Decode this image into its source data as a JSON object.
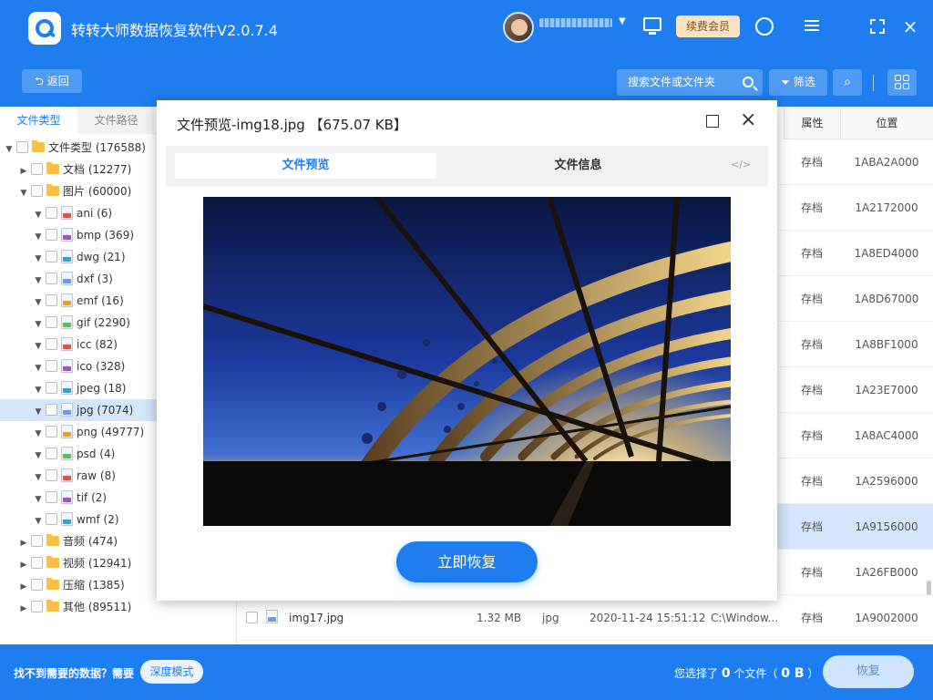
{
  "app": {
    "title": "转转大师数据恢复软件V2.0.7.4",
    "vip_label": "续费会员"
  },
  "toolbar": {
    "back_label": "返回",
    "search_placeholder": "搜索文件或文件夹",
    "filter_label": "筛选"
  },
  "sidebar": {
    "tabs": [
      "文件类型",
      "文件路径"
    ],
    "tree": [
      {
        "label": "文件类型 (176588)",
        "level": 0,
        "kind": "folder",
        "expanded": true
      },
      {
        "label": "文档 (12277)",
        "level": 1,
        "kind": "folder",
        "expanded": false
      },
      {
        "label": "图片 (60000)",
        "level": 1,
        "kind": "folder",
        "expanded": true
      },
      {
        "label": "ani (6)",
        "level": 2,
        "kind": "file"
      },
      {
        "label": "bmp (369)",
        "level": 2,
        "kind": "file"
      },
      {
        "label": "dwg (21)",
        "level": 2,
        "kind": "file"
      },
      {
        "label": "dxf (3)",
        "level": 2,
        "kind": "file"
      },
      {
        "label": "emf (16)",
        "level": 2,
        "kind": "file"
      },
      {
        "label": "gif (2290)",
        "level": 2,
        "kind": "file"
      },
      {
        "label": "icc (82)",
        "level": 2,
        "kind": "file"
      },
      {
        "label": "ico (328)",
        "level": 2,
        "kind": "file"
      },
      {
        "label": "jpeg (18)",
        "level": 2,
        "kind": "file"
      },
      {
        "label": "jpg (7074)",
        "level": 2,
        "kind": "file",
        "selected": true
      },
      {
        "label": "png (49777)",
        "level": 2,
        "kind": "file"
      },
      {
        "label": "psd (4)",
        "level": 2,
        "kind": "file"
      },
      {
        "label": "raw (8)",
        "level": 2,
        "kind": "file"
      },
      {
        "label": "tif (2)",
        "level": 2,
        "kind": "file"
      },
      {
        "label": "wmf (2)",
        "level": 2,
        "kind": "file"
      },
      {
        "label": "音频 (474)",
        "level": 1,
        "kind": "folder",
        "expanded": false
      },
      {
        "label": "视频 (12941)",
        "level": 1,
        "kind": "folder",
        "expanded": false
      },
      {
        "label": "压缩 (1385)",
        "level": 1,
        "kind": "folder",
        "expanded": false
      },
      {
        "label": "其他 (89511)",
        "level": 1,
        "kind": "folder",
        "expanded": false
      }
    ]
  },
  "table": {
    "headers": {
      "attribute": "属性",
      "position": "位置"
    },
    "rows": [
      {
        "attr": "存档",
        "pos": "1ABA2A000"
      },
      {
        "attr": "存档",
        "pos": "1A2172000"
      },
      {
        "attr": "存档",
        "pos": "1A8ED4000"
      },
      {
        "attr": "存档",
        "pos": "1A8D67000"
      },
      {
        "attr": "存档",
        "pos": "1A8BF1000"
      },
      {
        "attr": "存档",
        "pos": "1A23E7000"
      },
      {
        "attr": "存档",
        "pos": "1A8AC4000"
      },
      {
        "attr": "存档",
        "pos": "1A2596000"
      },
      {
        "attr": "存档",
        "pos": "1A9156000",
        "selected": true
      },
      {
        "attr": "存档",
        "pos": "1A26FB000"
      },
      {
        "attr": "存档",
        "pos": "1A9002000",
        "name": "img17.jpg",
        "size": "1.32 MB",
        "type": "jpg",
        "date": "2020-11-24 15:51:12",
        "path": "C:\\Window..."
      }
    ]
  },
  "bottom": {
    "cant_find": "找不到需要的数据？需要",
    "deep_mode": "深度模式",
    "selected_prefix": "您选择了",
    "selected_count": "0",
    "selected_mid": "个文件（",
    "selected_size": "0 B",
    "selected_suffix": "）",
    "recover_label": "恢复"
  },
  "dialog": {
    "title": "文件预览-img18.jpg 【675.07 KB】",
    "tab_preview": "文件预览",
    "tab_info": "文件信息",
    "code_icon": "</>",
    "restore_label": "立即恢复"
  },
  "icons": {
    "close": "×",
    "caret": "▼",
    "arrow_expanded": "▼",
    "arrow_collapsed": "▶"
  },
  "colors": {
    "accent": "#1e7ef0",
    "selected_row": "#d4e6fb",
    "vip_bg": "#fbe2c2"
  }
}
